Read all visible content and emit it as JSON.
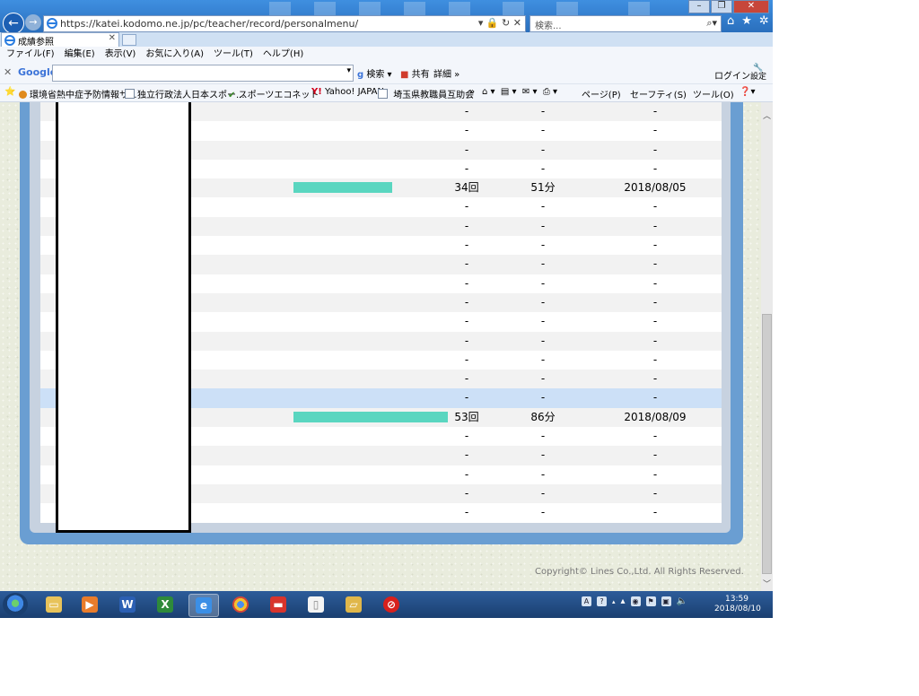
{
  "browser": {
    "url": "https://katei.kodomo.ne.jp/pc/teacher/record/personalmenu/",
    "search_placeholder": "検索...",
    "tab_title": "成績参照",
    "window_controls": [
      "minimize-icon",
      "restore-icon",
      "close-icon"
    ]
  },
  "menu": {
    "items": [
      "ファイル(F)",
      "編集(E)",
      "表示(V)",
      "お気に入り(A)",
      "ツール(T)",
      "ヘルプ(H)"
    ]
  },
  "google_toolbar": {
    "logo": "Google",
    "search_label": "検索",
    "share_label": "共有",
    "more_label": "詳細",
    "login_label": "ログイン",
    "settings_label": "設定"
  },
  "favorites": {
    "items": [
      "環境省熱中症予防情報サ...",
      "独立行政法人日本スポー...",
      "スポーツエコネット",
      "Yahoo! JAPAN",
      "埼玉県教職員互助会"
    ],
    "tools": [
      "ページ(P)",
      "セーフティ(S)",
      "ツール(O)"
    ]
  },
  "records": {
    "rows": [
      {
        "count": "-",
        "minutes": "-",
        "date": "-"
      },
      {
        "count": "-",
        "minutes": "-",
        "date": "-"
      },
      {
        "count": "-",
        "minutes": "-",
        "date": "-"
      },
      {
        "count": "-",
        "minutes": "-",
        "date": "-"
      },
      {
        "count": "34回",
        "minutes": "51分",
        "date": "2018/08/05",
        "bar_fraction": 0.64
      },
      {
        "count": "-",
        "minutes": "-",
        "date": "-"
      },
      {
        "count": "-",
        "minutes": "-",
        "date": "-"
      },
      {
        "count": "-",
        "minutes": "-",
        "date": "-"
      },
      {
        "count": "-",
        "minutes": "-",
        "date": "-"
      },
      {
        "count": "-",
        "minutes": "-",
        "date": "-"
      },
      {
        "count": "-",
        "minutes": "-",
        "date": "-"
      },
      {
        "count": "-",
        "minutes": "-",
        "date": "-"
      },
      {
        "count": "-",
        "minutes": "-",
        "date": "-"
      },
      {
        "count": "-",
        "minutes": "-",
        "date": "-"
      },
      {
        "count": "-",
        "minutes": "-",
        "date": "-"
      },
      {
        "count": "-",
        "minutes": "-",
        "date": "-",
        "highlight": true
      },
      {
        "count": "53回",
        "minutes": "86分",
        "date": "2018/08/09",
        "bar_fraction": 1.0
      },
      {
        "count": "-",
        "minutes": "-",
        "date": "-"
      },
      {
        "count": "-",
        "minutes": "-",
        "date": "-"
      },
      {
        "count": "-",
        "minutes": "-",
        "date": "-"
      },
      {
        "count": "-",
        "minutes": "-",
        "date": "-"
      },
      {
        "count": "-",
        "minutes": "-",
        "date": "-"
      }
    ]
  },
  "footer": {
    "copyright": "Copyright© Lines Co.,Ltd. All Rights Reserved."
  },
  "taskbar": {
    "apps": [
      "explorer-icon",
      "media-player-icon",
      "word-icon",
      "excel-icon",
      "internet-explorer-icon",
      "chrome-icon",
      "app-red-icon",
      "document-icon",
      "folder-icon",
      "trend-micro-icon"
    ],
    "time": "13:59",
    "date": "2018/08/10"
  },
  "colors": {
    "bar": "#5ad6c0",
    "frame": "#6a9ed2",
    "highlight_row": "#cce0f7"
  }
}
